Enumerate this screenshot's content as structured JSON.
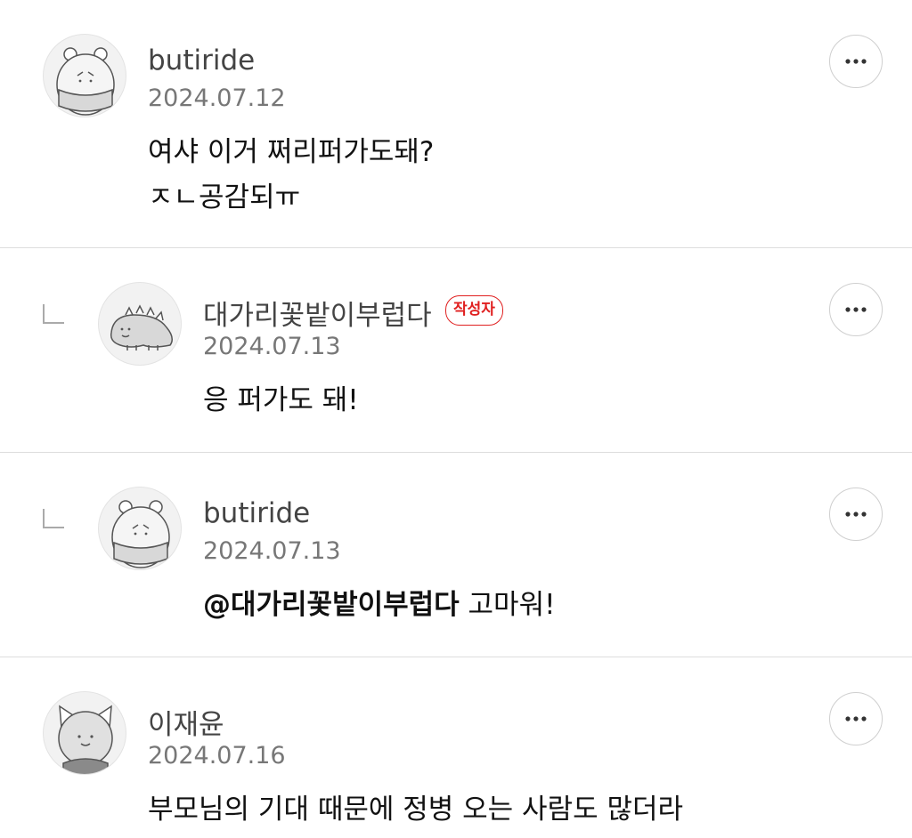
{
  "comments": [
    {
      "author": "butiride",
      "date": "2024.07.12",
      "lines": [
        "여샤 이거 쩌리퍼가도돼?",
        "ㅈㄴ공감되ㅠ"
      ],
      "avatar_icon": "hamster-avatar-icon"
    },
    {
      "author": "대가리꽃밭이부럽다",
      "badge": "작성자",
      "date": "2024.07.13",
      "lines": [
        "응 퍼가도 돼!"
      ],
      "avatar_icon": "dinosaur-avatar-icon"
    },
    {
      "author": "butiride",
      "date": "2024.07.13",
      "mention": "@대가리꽃밭이부럽다",
      "text": " 고마워!",
      "avatar_icon": "hamster-avatar-icon"
    },
    {
      "author": "이재윤",
      "date": "2024.07.16",
      "lines": [
        "부모님의 기대 때문에 정병 오는 사람도 많더라"
      ],
      "avatar_icon": "cat-avatar-icon"
    }
  ],
  "more_button_icon": "more-dots-icon",
  "reply_icon": "reply-arrow-icon",
  "colors": {
    "badge": "#e02020",
    "divider": "#dddddd",
    "date": "#777777"
  }
}
